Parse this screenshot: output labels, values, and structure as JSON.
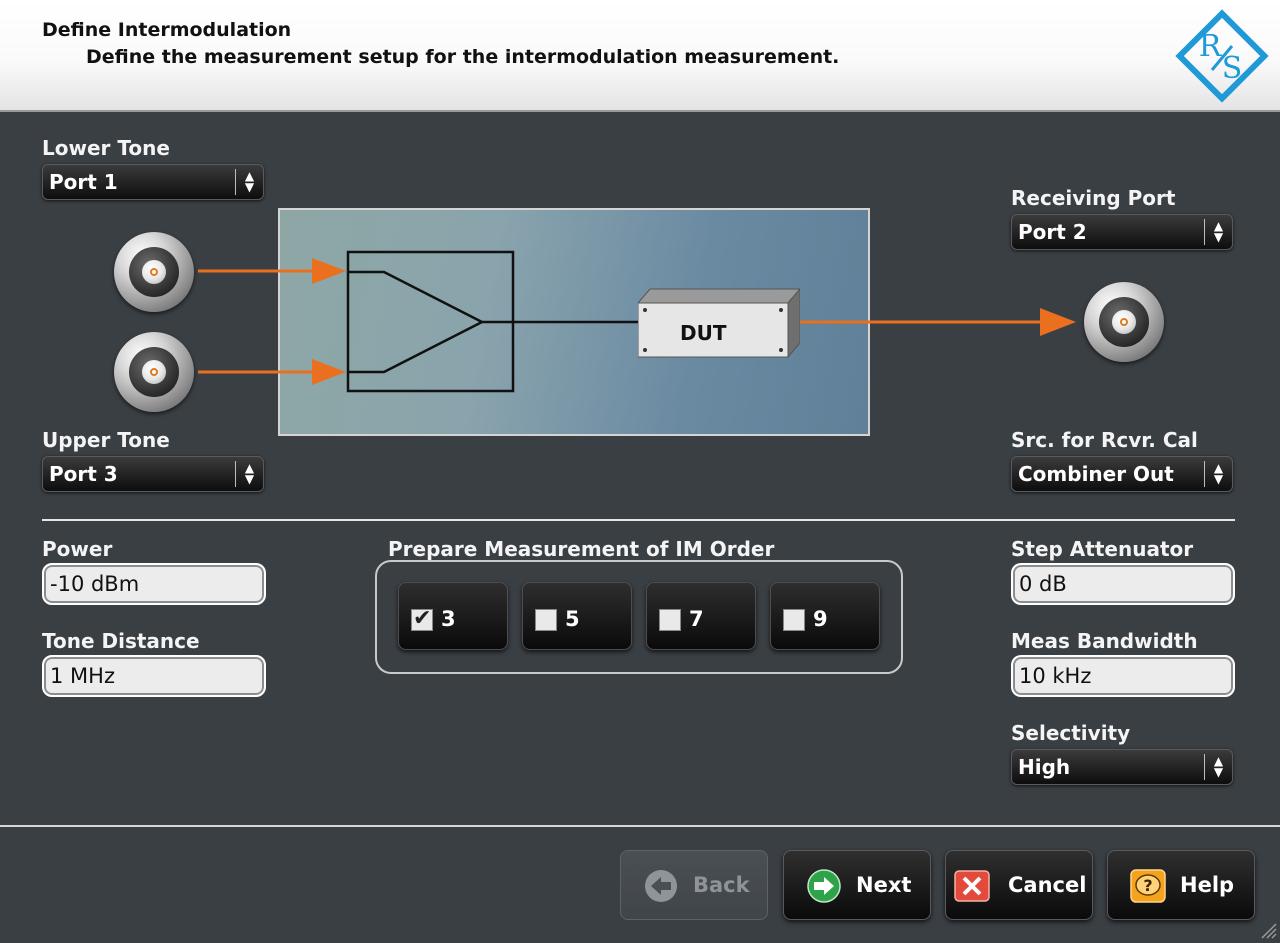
{
  "header": {
    "title": "Define Intermodulation",
    "subtitle": "Define the measurement setup for the intermodulation measurement.",
    "logo_text": "R&S"
  },
  "lower_tone": {
    "label": "Lower Tone",
    "value": "Port 1"
  },
  "upper_tone": {
    "label": "Upper Tone",
    "value": "Port 3"
  },
  "receiving_port": {
    "label": "Receiving Port",
    "value": "Port 2"
  },
  "src_rcvr_cal": {
    "label": "Src. for Rcvr. Cal",
    "value": "Combiner Out"
  },
  "diagram": {
    "dut_label": "DUT"
  },
  "power": {
    "label": "Power",
    "value": "-10 dBm"
  },
  "tone_distance": {
    "label": "Tone Distance",
    "value": "1 MHz"
  },
  "im_order": {
    "label": "Prepare Measurement of IM Order",
    "options": [
      {
        "value": "3",
        "checked": true
      },
      {
        "value": "5",
        "checked": false
      },
      {
        "value": "7",
        "checked": false
      },
      {
        "value": "9",
        "checked": false
      }
    ]
  },
  "step_attenuator": {
    "label": "Step Attenuator",
    "value": "0 dB"
  },
  "meas_bandwidth": {
    "label": "Meas Bandwidth",
    "value": "10 kHz"
  },
  "selectivity": {
    "label": "Selectivity",
    "value": "High"
  },
  "buttons": {
    "back": "Back",
    "next": "Next",
    "cancel": "Cancel",
    "help": "Help"
  },
  "colors": {
    "background": "#3a3f44",
    "signal_arrow": "#ea6f1e",
    "logo": "#1f9ad6"
  },
  "icons": {
    "back": "back-arrow-icon",
    "next": "next-arrow-icon",
    "cancel": "cancel-x-icon",
    "help": "help-question-icon",
    "connector": "rf-connector-icon"
  }
}
